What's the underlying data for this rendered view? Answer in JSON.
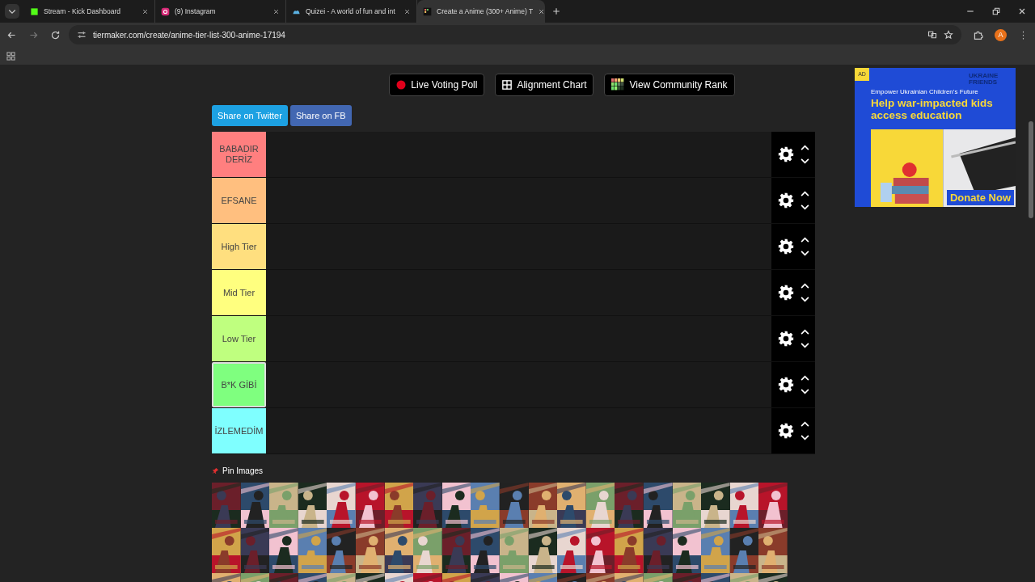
{
  "browser": {
    "tabs": [
      {
        "title": "Stream - Kick Dashboard",
        "selected": false
      },
      {
        "title": "(9) Instagram",
        "selected": false
      },
      {
        "title": "Quizei - A world of fun and int",
        "selected": false
      },
      {
        "title": "Create a Anime (300+ Anime) T",
        "selected": true
      }
    ],
    "url": "tiermaker.com/create/anime-tier-list-300-anime-17194",
    "profile": "A"
  },
  "toolbar_buttons": [
    {
      "label": "Live Voting Poll",
      "kind": "poll"
    },
    {
      "label": "Alignment Chart",
      "kind": "alignment"
    },
    {
      "label": "View Community Rank",
      "kind": "rank"
    }
  ],
  "share_buttons": [
    {
      "label": "Share on Twitter",
      "color": "#1da1e2"
    },
    {
      "label": "Share on FB",
      "color": "#4267b2"
    }
  ],
  "tiers": [
    {
      "label": "BABADIR DERİZ",
      "color": "#ff7f7f",
      "selected": false
    },
    {
      "label": "EFSANE",
      "color": "#ffbf7f",
      "selected": false
    },
    {
      "label": "High Tier",
      "color": "#ffdf7f",
      "selected": false
    },
    {
      "label": "Mid Tier",
      "color": "#ffff7f",
      "selected": false
    },
    {
      "label": "Low Tier",
      "color": "#bfff7f",
      "selected": false
    },
    {
      "label": "B*K GİBİ",
      "color": "#7fff7f",
      "selected": true
    },
    {
      "label": "İZLEMEDİM",
      "color": "#7fffff",
      "selected": false
    }
  ],
  "pin_images": {
    "label": "Pin Images"
  },
  "ad": {
    "badge": "AD",
    "logo": "UKRAINE FRIENDS",
    "tagline": "Empower Ukrainian Children’s Future",
    "headline": "Help war-impacted kids access education",
    "cta": "Donate Now"
  }
}
